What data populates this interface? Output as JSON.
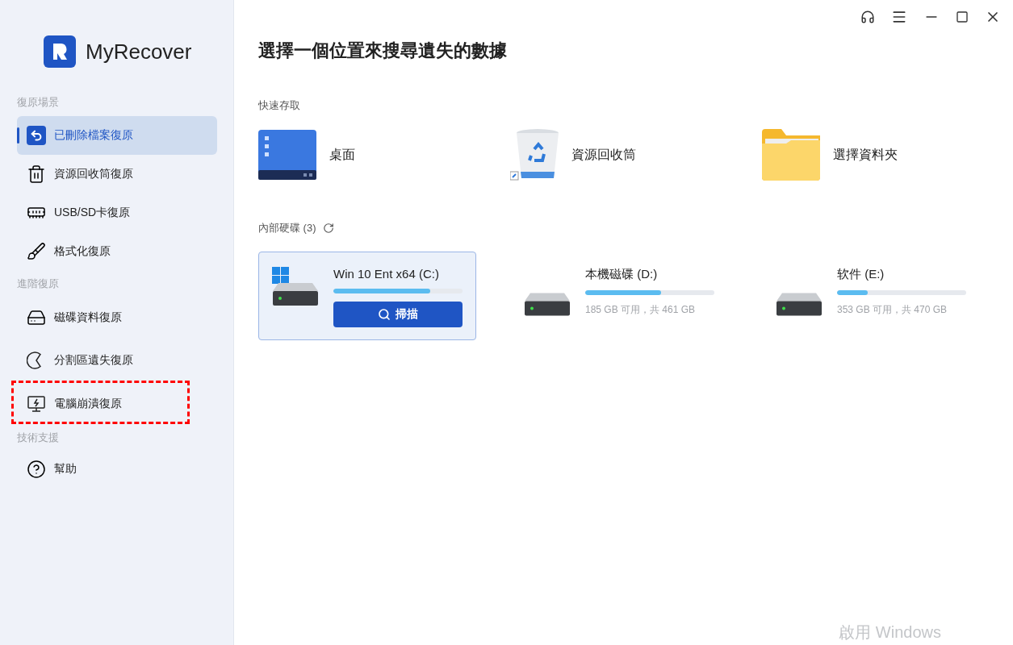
{
  "app": {
    "name": "MyRecover"
  },
  "sidebar": {
    "sections": [
      {
        "title": "復原場景",
        "items": [
          {
            "label": "已刪除檔案復原",
            "selected": true,
            "highlighted": false
          },
          {
            "label": "資源回收筒復原",
            "selected": false,
            "highlighted": false
          },
          {
            "label": "USB/SD卡復原",
            "selected": false,
            "highlighted": false
          },
          {
            "label": "格式化復原",
            "selected": false,
            "highlighted": false
          }
        ]
      },
      {
        "title": "進階復原",
        "items": [
          {
            "label": "磁碟資料復原",
            "selected": false,
            "highlighted": false
          },
          {
            "label": "分割區遺失復原",
            "selected": false,
            "highlighted": false
          },
          {
            "label": "電腦崩潰復原",
            "selected": false,
            "highlighted": true
          }
        ]
      },
      {
        "title": "技術支援",
        "items": [
          {
            "label": "幫助",
            "selected": false,
            "highlighted": false
          }
        ]
      }
    ]
  },
  "main": {
    "title": "選擇一個位置來搜尋遺失的數據",
    "quick_access": {
      "title": "快速存取",
      "items": [
        "桌面",
        "資源回收筒",
        "選擇資料夾"
      ]
    },
    "drives": {
      "title": "內部硬碟 (3)",
      "items": [
        {
          "name": "Win 10 Ent x64 (C:)",
          "level": 0.75,
          "selected": true,
          "system": true,
          "scan_button": "掃描"
        },
        {
          "name": "本機磁碟 (D:)",
          "level": 0.59,
          "selected": false,
          "system": false,
          "info": "185 GB 可用，共 461 GB"
        },
        {
          "name": "软件 (E:)",
          "level": 0.24,
          "selected": false,
          "system": false,
          "info": "353 GB 可用，共 470 GB"
        }
      ]
    }
  },
  "activation_notice": "啟用 Windows"
}
